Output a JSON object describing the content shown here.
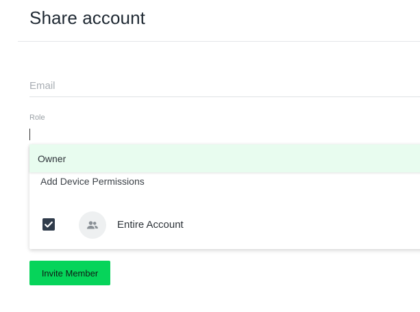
{
  "header": {
    "title": "Share account"
  },
  "form": {
    "email_placeholder": "Email",
    "email_value": "",
    "role_label": "Role",
    "role_value": ""
  },
  "role_dropdown": {
    "options": [
      {
        "label": "Owner",
        "highlighted": true
      }
    ],
    "permissions_heading": "Add Device Permissions",
    "permissions": [
      {
        "label": "Entire Account",
        "checked": true,
        "icon": "group-icon"
      }
    ]
  },
  "actions": {
    "invite_label": "Invite Member"
  },
  "colors": {
    "accent": "#06d45a",
    "highlight": "#e8fcef",
    "checkbox": "#2f3b4a"
  }
}
